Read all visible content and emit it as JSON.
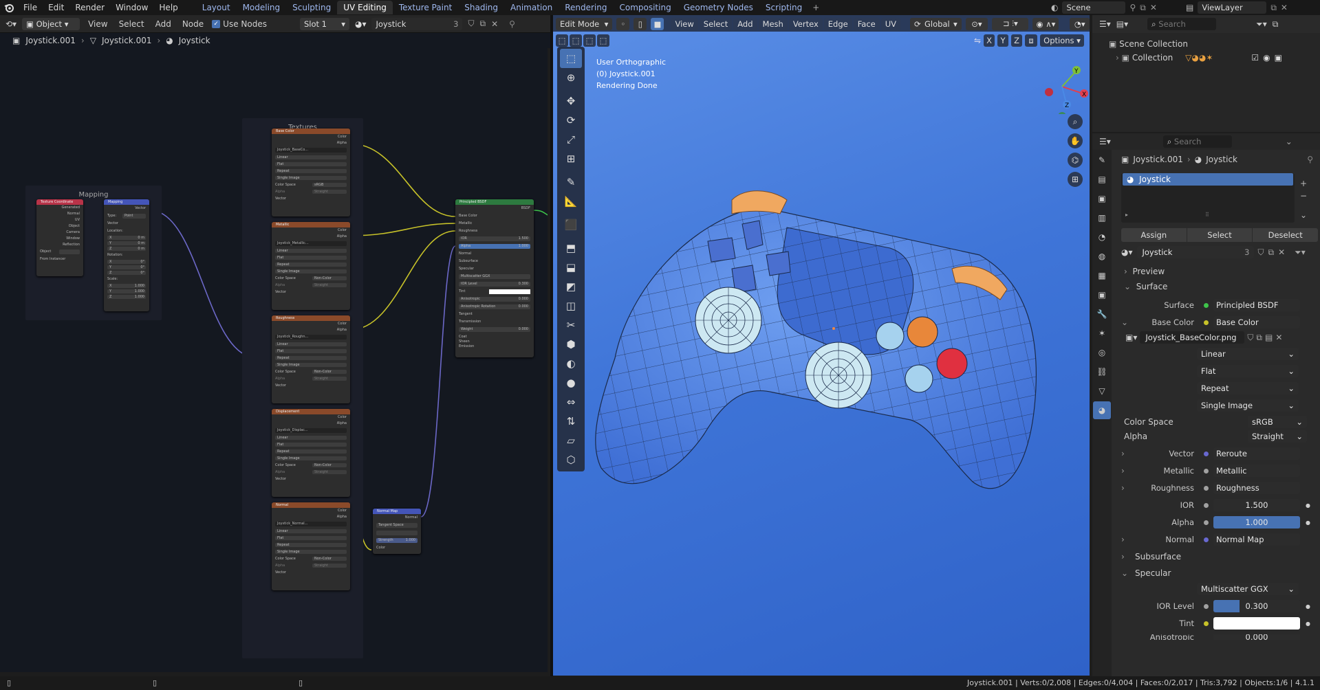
{
  "topbar": {
    "menus": [
      "File",
      "Edit",
      "Render",
      "Window",
      "Help"
    ],
    "workspaces": [
      "Layout",
      "Modeling",
      "Sculpting",
      "UV Editing",
      "Texture Paint",
      "Shading",
      "Animation",
      "Rendering",
      "Compositing",
      "Geometry Nodes",
      "Scripting"
    ],
    "active_workspace": "UV Editing",
    "scene": "Scene",
    "view_layer": "ViewLayer"
  },
  "node_header": {
    "mode": "Object",
    "menus": [
      "View",
      "Select",
      "Add",
      "Node"
    ],
    "use_nodes": "Use Nodes",
    "slot": "Slot 1",
    "material": "Joystick",
    "users": "3"
  },
  "breadcrumb": [
    "Joystick.001",
    "Joystick.001",
    "Joystick"
  ],
  "node_frames": {
    "mapping": "Mapping",
    "textures": "Textures"
  },
  "nodes": {
    "texcoord": {
      "title": "Texture Coordinate",
      "outputs": [
        "Generated",
        "Normal",
        "UV",
        "Object",
        "Camera",
        "Window",
        "Reflection"
      ],
      "object": "Object",
      "from_instancer": "From Instancer"
    },
    "mapping": {
      "title": "Mapping",
      "output": "Vector",
      "type_label": "Type:",
      "type": "Point",
      "vector": "Vector",
      "location": "Location:",
      "rotation": "Rotation:",
      "scale": "Scale:",
      "loc": [
        "0 m",
        "0 m",
        "0 m"
      ],
      "rot": [
        "0°",
        "0°",
        "0°"
      ],
      "scl": [
        "1.000",
        "1.000",
        "1.000"
      ],
      "axes": [
        "X",
        "Y",
        "Z"
      ]
    },
    "textures": [
      {
        "title": "Base Color",
        "image": "Joystick_BaseCo...",
        "color_space": "sRGB"
      },
      {
        "title": "Metallic",
        "image": "Joystick_Metallic...",
        "color_space": "Non-Color"
      },
      {
        "title": "Roughness",
        "image": "Joystick_Roughn...",
        "color_space": "Non-Color"
      },
      {
        "title": "Displacement",
        "image": "Joystick_Displac...",
        "color_space": "Non-Color"
      },
      {
        "title": "Normal",
        "image": "Joystick_Normal...",
        "color_space": "Non-Color"
      }
    ],
    "tex_rows": {
      "color": "Color",
      "alpha": "Alpha",
      "interp": "Linear",
      "proj": "Flat",
      "ext": "Repeat",
      "src": "Single Image",
      "cs_label": "Color Space",
      "alpha_label": "Alpha",
      "alpha_mode": "Straight",
      "vector": "Vector"
    },
    "normal_map": {
      "title": "Normal Map",
      "output": "Normal",
      "space": "Tangent Space",
      "strength_label": "Strength",
      "strength": "1.000",
      "color": "Color"
    },
    "bsdf": {
      "title": "Principled BSDF",
      "output": "BSDF",
      "inputs": [
        "Base Color",
        "Metallic",
        "Roughness"
      ],
      "ior_label": "IOR",
      "ior": "1.500",
      "alpha_label": "Alpha",
      "alpha": "1.000",
      "normal": "Normal",
      "subsurface": "Subsurface",
      "specular": "Specular",
      "dist": "Multiscatter GGX",
      "ior_level_label": "IOR Level",
      "ior_level": "0.300",
      "tint": "Tint",
      "aniso": "Anisotropic",
      "aniso_val": "0.000",
      "aniso_rot": "Anisotropic Rotation",
      "aniso_rot_val": "0.000",
      "tangent": "Tangent",
      "transmission": "Transmission",
      "weight": "Weight",
      "weight_val": "0.000",
      "coat": "Coat",
      "sheen": "Sheen",
      "emission": "Emission"
    }
  },
  "viewport": {
    "mode": "Edit Mode",
    "menus": [
      "View",
      "Select",
      "Add",
      "Mesh",
      "Vertex",
      "Edge",
      "Face",
      "UV"
    ],
    "orientation": "Global",
    "options": "Options",
    "axes_lock": [
      "X",
      "Y",
      "Z"
    ],
    "info": [
      "User Orthographic",
      "(0) Joystick.001",
      "Rendering Done"
    ]
  },
  "outliner": {
    "search_placeholder": "Search",
    "scene_collection": "Scene Collection",
    "collection": "Collection"
  },
  "properties": {
    "search_placeholder": "Search",
    "breadcrumb_obj": "Joystick.001",
    "breadcrumb_mat": "Joystick",
    "slot_name": "Joystick",
    "assign": "Assign",
    "select": "Select",
    "deselect": "Deselect",
    "material": "Joystick",
    "users": "3",
    "preview": "Preview",
    "surface_panel": "Surface",
    "rows": [
      {
        "label": "Surface",
        "value": "Principled BSDF",
        "dot": "#3ec44a"
      },
      {
        "label": "Base Color",
        "value": "Base Color",
        "dot": "#c7c229"
      }
    ],
    "image": "Joystick_BaseColor.png",
    "interp": "Linear",
    "proj": "Flat",
    "ext": "Repeat",
    "src": "Single Image",
    "cs_label": "Color Space",
    "cs": "sRGB",
    "alpha_label": "Alpha",
    "alpha_mode": "Straight",
    "links": [
      {
        "label": "Vector",
        "value": "Reroute",
        "dot": "#6868d0"
      },
      {
        "label": "Metallic",
        "value": "Metallic",
        "dot": "#a1a1a1"
      },
      {
        "label": "Roughness",
        "value": "Roughness",
        "dot": "#a1a1a1"
      }
    ],
    "ior_label": "IOR",
    "ior": "1.500",
    "alpha2_label": "Alpha",
    "alpha2": "1.000",
    "normal_label": "Normal",
    "normal": "Normal Map",
    "subsurface": "Subsurface",
    "specular": "Specular",
    "dist": "Multiscatter GGX",
    "ior_level_label": "IOR Level",
    "ior_level": "0.300",
    "tint_label": "Tint",
    "aniso_label": "Anisotropic",
    "aniso": "0.000"
  },
  "status": {
    "text": "Joystick.001 | Verts:0/2,008 | Edges:0/4,004 | Faces:0/2,017 | Tris:3,792 | Objects:1/6 | 4.1.1"
  },
  "colors": {
    "accent": "#4772b3",
    "viewport_bg": "#3f75d8",
    "wire": "#1a2a4a"
  }
}
